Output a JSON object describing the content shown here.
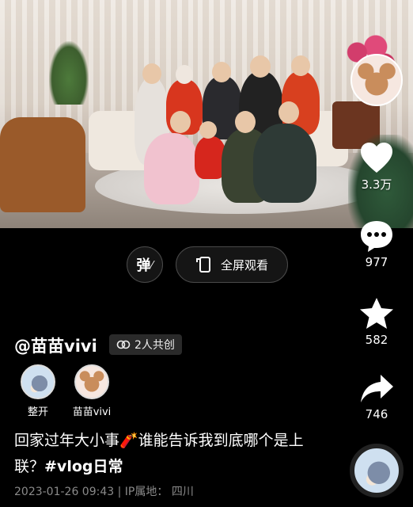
{
  "rail": {
    "likes": "3.3万",
    "comments": "977",
    "favorites": "582",
    "shares": "746",
    "accent_color": "#ffffff"
  },
  "controls": {
    "danmaku_label": "弹",
    "fullscreen_label": "全屏观看"
  },
  "post": {
    "author": "@苗苗vivi",
    "collab_label": "2人共创",
    "creators": [
      {
        "name": "整开",
        "avatar": "cat-avatar"
      },
      {
        "name": "苗苗vivi",
        "avatar": "mouse-avatar"
      }
    ],
    "caption_text": "回家过年大小事🧨谁能告诉我到底哪个是上联？",
    "caption_tag": "#vlog日常",
    "date": "2023-01-26 09:43",
    "ip_label": "IP属地：",
    "ip_location": "四川"
  }
}
